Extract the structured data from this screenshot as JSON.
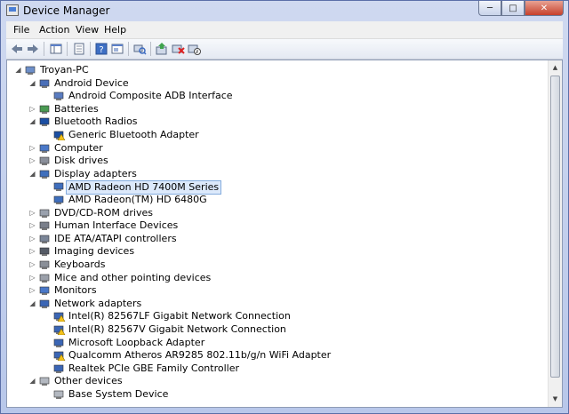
{
  "window": {
    "title": "Device Manager"
  },
  "menu": {
    "items": [
      "File",
      "Action",
      "View",
      "Help"
    ]
  },
  "tree": [
    {
      "label": "Troyan-PC",
      "level": 0,
      "expanded": true,
      "icon": "computer-icon"
    },
    {
      "label": "Android Device",
      "level": 1,
      "expanded": true,
      "icon": "device-category-icon"
    },
    {
      "label": "Android Composite ADB Interface",
      "level": 2,
      "icon": "device-icon"
    },
    {
      "label": "Batteries",
      "level": 1,
      "expanded": false,
      "icon": "battery-icon"
    },
    {
      "label": "Bluetooth Radios",
      "level": 1,
      "expanded": true,
      "icon": "bluetooth-icon"
    },
    {
      "label": "Generic Bluetooth Adapter",
      "level": 2,
      "icon": "bluetooth-warning-icon"
    },
    {
      "label": "Computer",
      "level": 1,
      "expanded": false,
      "icon": "monitor-icon"
    },
    {
      "label": "Disk drives",
      "level": 1,
      "expanded": false,
      "icon": "disk-icon"
    },
    {
      "label": "Display adapters",
      "level": 1,
      "expanded": true,
      "icon": "display-adapter-icon"
    },
    {
      "label": "AMD Radeon HD 7400M Series",
      "level": 2,
      "icon": "display-adapter-icon",
      "selected": true
    },
    {
      "label": "AMD Radeon(TM) HD 6480G",
      "level": 2,
      "icon": "display-adapter-icon"
    },
    {
      "label": "DVD/CD-ROM drives",
      "level": 1,
      "expanded": false,
      "icon": "dvd-icon"
    },
    {
      "label": "Human Interface Devices",
      "level": 1,
      "expanded": false,
      "icon": "hid-icon"
    },
    {
      "label": "IDE ATA/ATAPI controllers",
      "level": 1,
      "expanded": false,
      "icon": "ide-icon"
    },
    {
      "label": "Imaging devices",
      "level": 1,
      "expanded": false,
      "icon": "camera-icon"
    },
    {
      "label": "Keyboards",
      "level": 1,
      "expanded": false,
      "icon": "keyboard-icon"
    },
    {
      "label": "Mice and other pointing devices",
      "level": 1,
      "expanded": false,
      "icon": "mouse-icon"
    },
    {
      "label": "Monitors",
      "level": 1,
      "expanded": false,
      "icon": "monitor-icon"
    },
    {
      "label": "Network adapters",
      "level": 1,
      "expanded": true,
      "icon": "network-icon"
    },
    {
      "label": "Intel(R) 82567LF Gigabit Network Connection",
      "level": 2,
      "icon": "network-warning-icon"
    },
    {
      "label": "Intel(R) 82567V Gigabit Network Connection",
      "level": 2,
      "icon": "network-warning-icon"
    },
    {
      "label": "Microsoft Loopback Adapter",
      "level": 2,
      "icon": "network-icon"
    },
    {
      "label": "Qualcomm Atheros AR9285 802.11b/g/n WiFi Adapter",
      "level": 2,
      "icon": "network-warning-icon"
    },
    {
      "label": "Realtek PCIe GBE Family Controller",
      "level": 2,
      "icon": "network-icon"
    },
    {
      "label": "Other devices",
      "level": 1,
      "expanded": true,
      "icon": "unknown-device-icon"
    },
    {
      "label": "Base System Device",
      "level": 2,
      "icon": "unknown-device-icon"
    }
  ]
}
